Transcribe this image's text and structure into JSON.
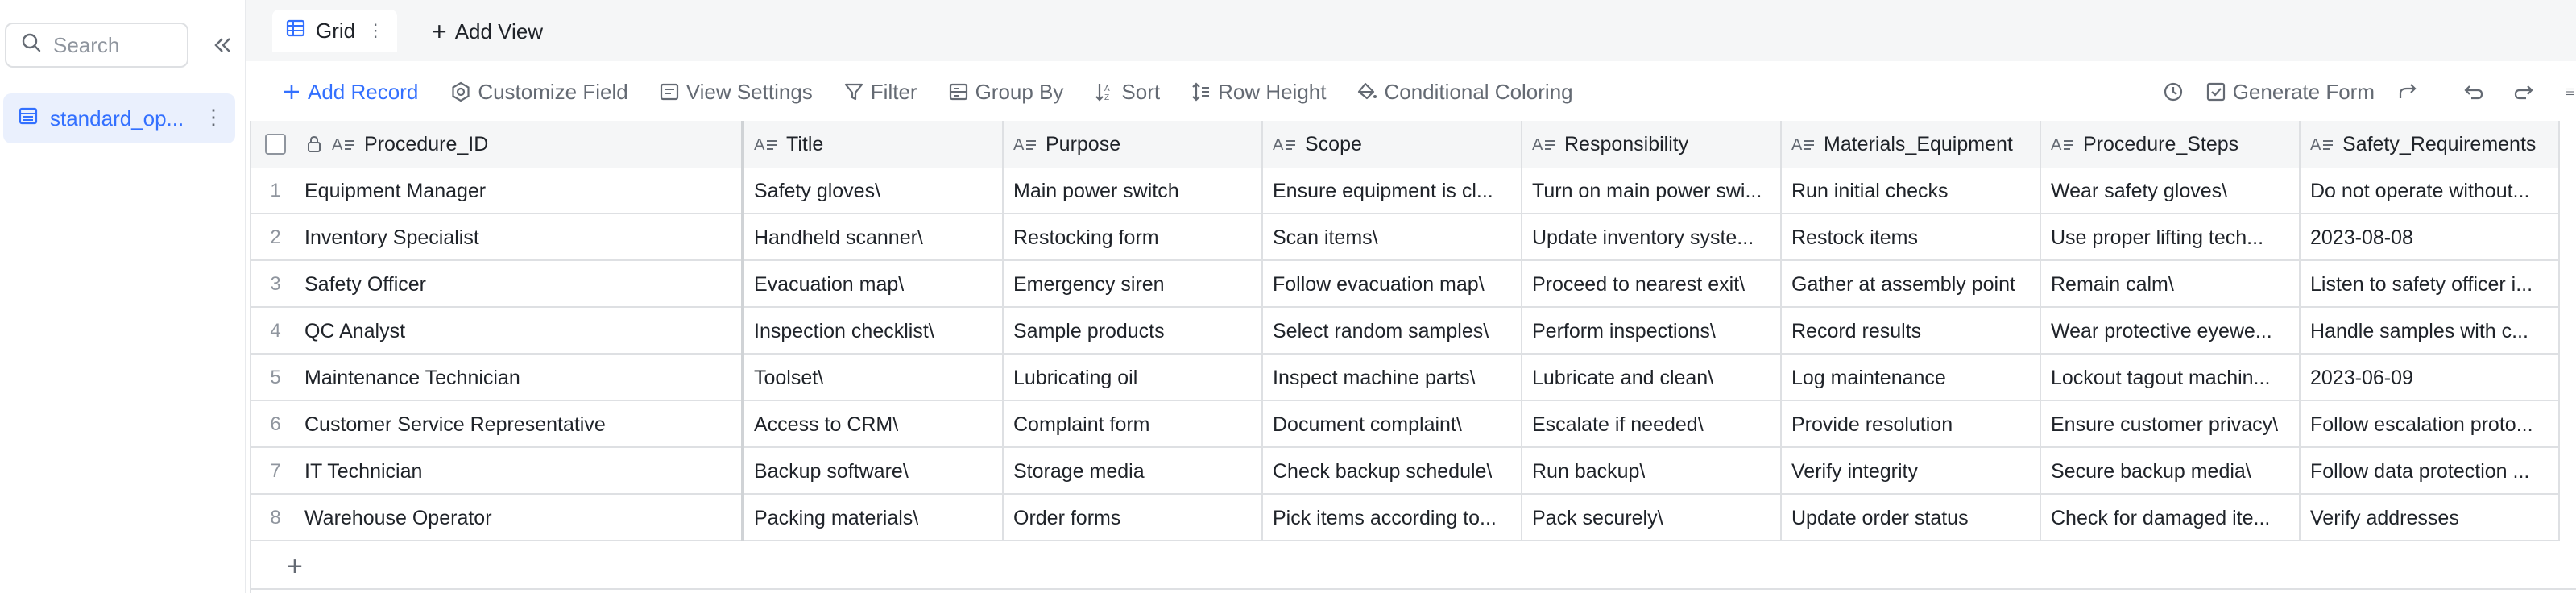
{
  "sidebar": {
    "search_placeholder": "Search",
    "collapse_icon": "double-chevron-left-icon",
    "table_name": "standard_op...",
    "table_icon": "table-icon"
  },
  "tabs": {
    "grid_label": "Grid",
    "add_view_label": "Add View"
  },
  "toolbar": {
    "add_record": "Add Record",
    "customize_field": "Customize Field",
    "view_settings": "View Settings",
    "filter": "Filter",
    "group_by": "Group By",
    "sort": "Sort",
    "row_height": "Row Height",
    "conditional_coloring": "Conditional Coloring",
    "generate_form": "Generate Form"
  },
  "columns": [
    "Procedure_ID",
    "Title",
    "Purpose",
    "Scope",
    "Responsibility",
    "Materials_Equipment",
    "Procedure_Steps",
    "Safety_Requirements"
  ],
  "rows": [
    {
      "num": "1",
      "cells": [
        "Equipment Manager",
        "Safety gloves\\",
        "Main power switch",
        "Ensure equipment is cl...",
        "Turn on main power swi...",
        "Run initial checks",
        "Wear safety gloves\\",
        "Do not operate without..."
      ]
    },
    {
      "num": "2",
      "cells": [
        "Inventory Specialist",
        "Handheld scanner\\",
        "Restocking form",
        "Scan items\\",
        "Update inventory syste...",
        "Restock items",
        "Use proper lifting tech...",
        "2023-08-08"
      ]
    },
    {
      "num": "3",
      "cells": [
        "Safety Officer",
        "Evacuation map\\",
        "Emergency siren",
        "Follow evacuation map\\",
        "Proceed to nearest exit\\",
        "Gather at assembly point",
        "Remain calm\\",
        "Listen to safety officer i..."
      ]
    },
    {
      "num": "4",
      "cells": [
        "QC Analyst",
        "Inspection checklist\\",
        "Sample products",
        "Select random samples\\",
        "Perform inspections\\",
        "Record results",
        "Wear protective eyewe...",
        "Handle samples with c..."
      ]
    },
    {
      "num": "5",
      "cells": [
        "Maintenance Technician",
        "Toolset\\",
        "Lubricating oil",
        "Inspect machine parts\\",
        "Lubricate and clean\\",
        "Log maintenance",
        "Lockout tagout machin...",
        "2023-06-09"
      ]
    },
    {
      "num": "6",
      "cells": [
        "Customer Service Representative",
        "Access to CRM\\",
        "Complaint form",
        "Document complaint\\",
        "Escalate if needed\\",
        "Provide resolution",
        "Ensure customer privacy\\",
        "Follow escalation proto..."
      ]
    },
    {
      "num": "7",
      "cells": [
        "IT Technician",
        "Backup software\\",
        "Storage media",
        "Check backup schedule\\",
        "Run backup\\",
        "Verify integrity",
        "Secure backup media\\",
        "Follow data protection ..."
      ]
    },
    {
      "num": "8",
      "cells": [
        "Warehouse Operator",
        "Packing materials\\",
        "Order forms",
        "Pick items according to...",
        "Pack securely\\",
        "Update order status",
        "Check for damaged ite...",
        "Verify addresses"
      ]
    }
  ],
  "colors": {
    "accent": "#3370ff",
    "header_bg": "#f5f6f7",
    "border": "#dee0e3",
    "selected_bg": "#eaf0fd"
  }
}
